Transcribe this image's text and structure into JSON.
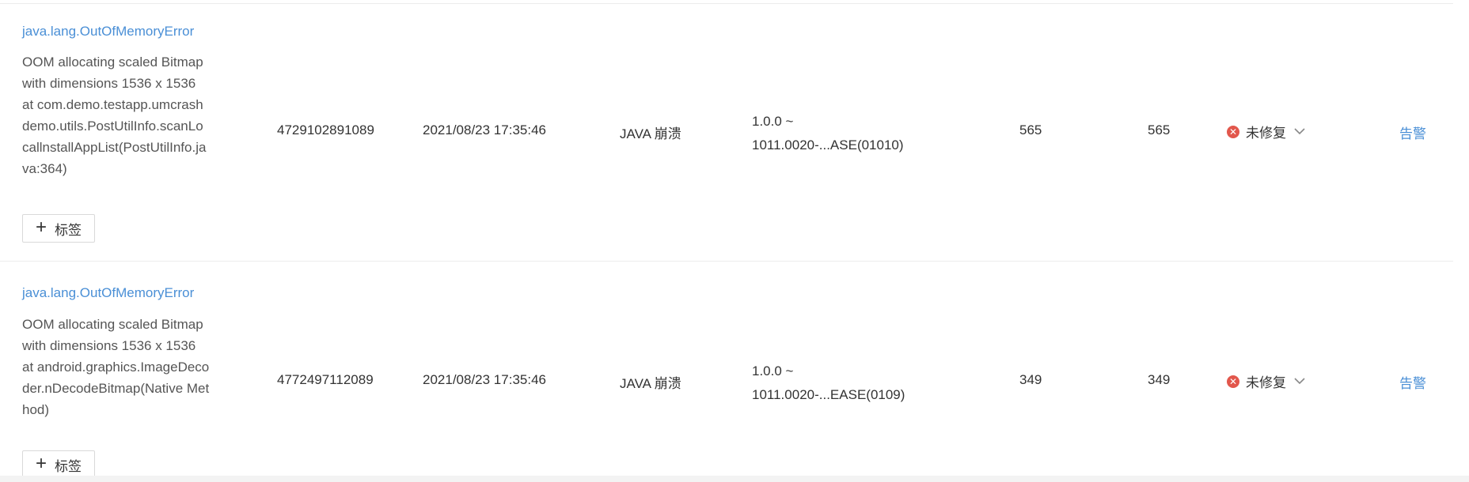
{
  "rows": [
    {
      "error_type": "java.lang.OutOfMemoryError",
      "message": "OOM allocating scaled Bitmap\nwith dimensions 1536 x 1536\nat com.demo.testapp.umcrash\ndemo.utils.PostUtilInfo.scanLo\ncallnstallAppList(PostUtilInfo.ja\nva:364)",
      "tag_label": "标签",
      "id": "4729102891089",
      "time": "2021/08/23 17:35:46",
      "crash_type": "JAVA 崩溃",
      "version": "1.0.0 ~\n1011.0020-...ASE(01010)",
      "count_a": "565",
      "count_b": "565",
      "status": "未修复",
      "action": "告警"
    },
    {
      "error_type": "java.lang.OutOfMemoryError",
      "message": "OOM allocating scaled Bitmap\nwith dimensions 1536 x 1536\nat android.graphics.ImageDeco\nder.nDecodeBitmap(Native Met\nhod)",
      "tag_label": "标签",
      "id": "4772497112089",
      "time": "2021/08/23 17:35:46",
      "crash_type": "JAVA 崩溃",
      "version": "1.0.0 ~\n1011.0020-...EASE(0109)",
      "count_a": "349",
      "count_b": "349",
      "status": "未修复",
      "action": "告警"
    }
  ],
  "colors": {
    "link": "#4a8fd6",
    "status_error": "#e2574c",
    "divider": "#ececec"
  },
  "icons": {
    "status": "close-circle-icon",
    "dropdown": "chevron-down-icon",
    "add": "plus-icon"
  }
}
